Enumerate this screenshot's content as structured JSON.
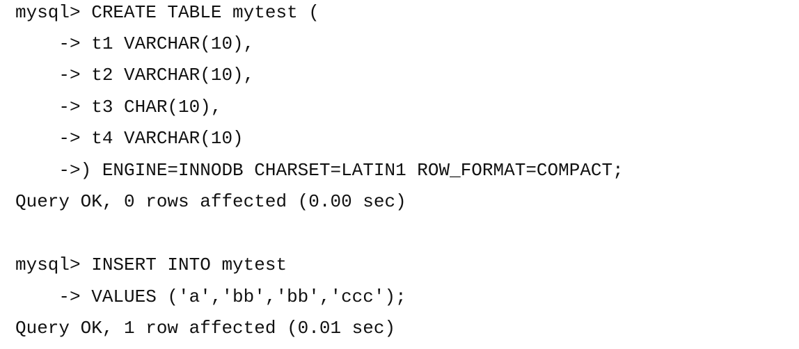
{
  "terminal": {
    "lines": [
      "mysql> CREATE TABLE mytest (",
      "    -> t1 VARCHAR(10),",
      "    -> t2 VARCHAR(10),",
      "    -> t3 CHAR(10),",
      "    -> t4 VARCHAR(10)",
      "    ->) ENGINE=INNODB CHARSET=LATIN1 ROW_FORMAT=COMPACT;",
      "Query OK, 0 rows affected (0.00 sec)",
      "",
      "mysql> INSERT INTO mytest",
      "    -> VALUES ('a','bb','bb','ccc');",
      "Query OK, 1 row affected (0.01 sec)"
    ]
  }
}
